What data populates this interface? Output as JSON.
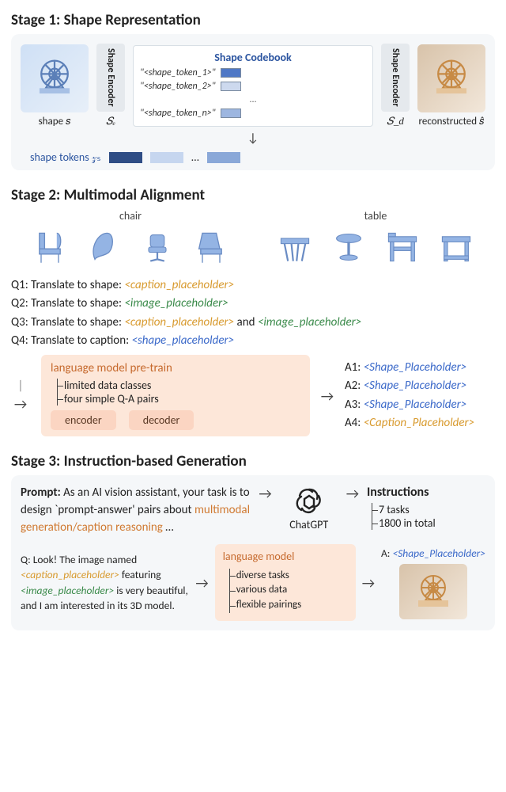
{
  "stage1": {
    "title": "Stage 1: Shape Representation",
    "input_label": "shape 𝑠",
    "encoder_label": "Shape Encoder",
    "encoder_sym": "𝑆ₑ",
    "codebook_title": "Shape Codebook",
    "codebook_entries": [
      "\"<shape_token_1>\"",
      "\"<shape_token_2>\"",
      "...",
      "\"<shape_token_n>\""
    ],
    "decoder_label": "Shape Encoder",
    "decoder_sym": "𝑆_d",
    "output_label": "reconstructed 𝑠̂",
    "tokens_label": "shape tokens 𝓏ₛ",
    "tokens_ellipsis": "..."
  },
  "stage2": {
    "title": "Stage 2: Multimodal Alignment",
    "group_labels": [
      "chair",
      "table"
    ],
    "q_prefix": [
      "Q1: Translate to shape: ",
      "Q2: Translate to shape: ",
      "Q3: Translate to shape: ",
      "Q4: Translate to caption: "
    ],
    "q3_join": " and ",
    "ph_caption": "<caption_placeholder>",
    "ph_image": "<image_placeholder>",
    "ph_shape": "<shape_placeholder>",
    "lm_title": "language model pre-train",
    "lm_items": [
      "limited data classes",
      "four simple Q-A pairs"
    ],
    "sub_boxes": [
      "encoder",
      "decoder"
    ],
    "answers_label": [
      "A1: ",
      "A2: ",
      "A3: ",
      "A4: "
    ],
    "ans_shape": "<Shape_Placeholder>",
    "ans_caption": "<Caption_Placeholder>"
  },
  "stage3": {
    "title": "Stage 3: Instruction-based Generation",
    "prompt_lead": "Prompt: ",
    "prompt_body1": "As an AI vision assistant, your task is to design `prompt-answer' pairs about ",
    "prompt_emph": "multimodal generation/caption reasoning",
    "prompt_tail": " …",
    "gpt_label": "ChatGPT",
    "instr_title": "Instructions",
    "instr_items": [
      "7 tasks",
      "1800 in total"
    ],
    "q_text_1": "Q: Look! The image named ",
    "q_text_2": " featuring ",
    "q_text_3": " is very beautiful, and I am interested in its 3D model.",
    "lm2_title": "language model",
    "lm2_items": [
      "diverse tasks",
      "various data",
      "flexible pairings"
    ],
    "ans_label": "A: ",
    "ans_shape": "<Shape_Placeholder>"
  }
}
